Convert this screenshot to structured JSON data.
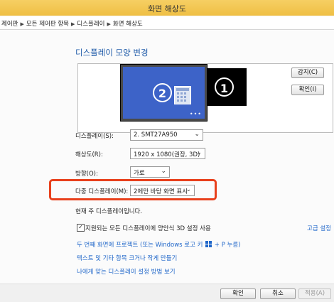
{
  "window": {
    "title": "화면 해상도"
  },
  "breadcrumb": {
    "items": [
      "제어판",
      "모든 제어판 항목",
      "디스플레이",
      "화면 해상도"
    ]
  },
  "main": {
    "heading": "디스플레이 모양 변경",
    "monitors": {
      "primary_number": "1",
      "secondary_number": "2",
      "more_dots": "•••"
    },
    "detect_button": "감지(C)",
    "identify_button": "확인(I)",
    "display": {
      "label": "디스플레이(S):",
      "value": "2. SMT27A950"
    },
    "resolution": {
      "label": "해상도(R):",
      "value": "1920 x 1080(권장, 3D)"
    },
    "orientation": {
      "label": "방향(O):",
      "value": "가로"
    },
    "multiple_displays": {
      "label": "다중 디스플레이(M):",
      "value": "2에만 바탕 화면 표시"
    },
    "main_display_note": "현재 주 디스플레이입니다.",
    "checkbox": {
      "checked": true,
      "label": "지원되는 모든 디스플레이에 양안식 3D 설정 사용"
    },
    "advanced_link": "고급 설정",
    "links": {
      "project_pre": "두 번째 화면에 프로젝트 (또는 Windows 로고 키",
      "project_post": "+ P 누름)",
      "text_size": "텍스트 및 기타 항목 크거나 작게 만들기",
      "help": "나에게 맞는 디스플레이 설정 방법 보기"
    }
  },
  "footer": {
    "ok": "확인",
    "cancel": "취소",
    "apply": "적용(A)"
  },
  "colors": {
    "titlebar": "#f0c24b",
    "heading": "#1e5aa8",
    "link": "#1f66c9",
    "highlight": "#e8401c",
    "selected_monitor": "#3d63c8"
  }
}
